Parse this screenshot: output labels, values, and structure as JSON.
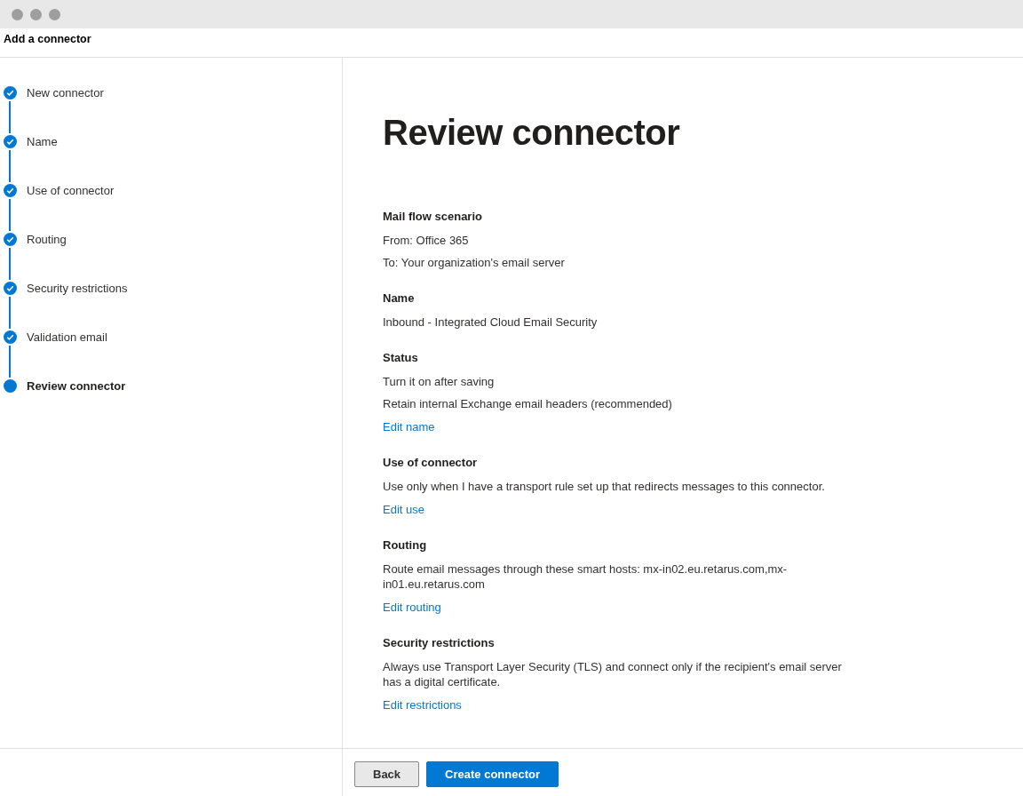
{
  "window": {
    "title": "Add a connector"
  },
  "steps": [
    {
      "label": "New connector",
      "selected": false
    },
    {
      "label": "Name",
      "selected": false
    },
    {
      "label": "Use of connector",
      "selected": false
    },
    {
      "label": "Routing",
      "selected": false
    },
    {
      "label": "Security restrictions",
      "selected": false
    },
    {
      "label": "Validation email",
      "selected": false
    },
    {
      "label": "Review connector",
      "selected": true
    }
  ],
  "page_title": "Review connector",
  "sections": [
    {
      "heading": "Mail flow scenario",
      "lines": [
        "From: Office 365",
        "To: Your organization's email server"
      ]
    },
    {
      "heading": "Name",
      "lines": [
        "Inbound - Integrated Cloud Email Security"
      ]
    },
    {
      "heading": "Status",
      "lines": [
        "Turn it on after saving",
        "Retain internal Exchange email headers (recommended)"
      ],
      "link": "Edit name"
    },
    {
      "heading": "Use of connector",
      "lines": [
        "Use only when I have a transport rule set up that redirects messages to this connector."
      ],
      "link": "Edit use"
    },
    {
      "heading": "Routing",
      "lines": [
        "Route email messages through these smart hosts: mx-in02.eu.retarus.com,mx-in01.eu.retarus.com"
      ],
      "link": "Edit routing"
    },
    {
      "heading": "Security restrictions",
      "lines": [
        "Always use Transport Layer Security (TLS) and connect only if the recipient's email server has a digital certificate."
      ],
      "link": "Edit restrictions"
    }
  ],
  "buttons": [
    {
      "label": "Back",
      "kind": "secondary"
    },
    {
      "label": "Create connector",
      "kind": "primary"
    }
  ]
}
